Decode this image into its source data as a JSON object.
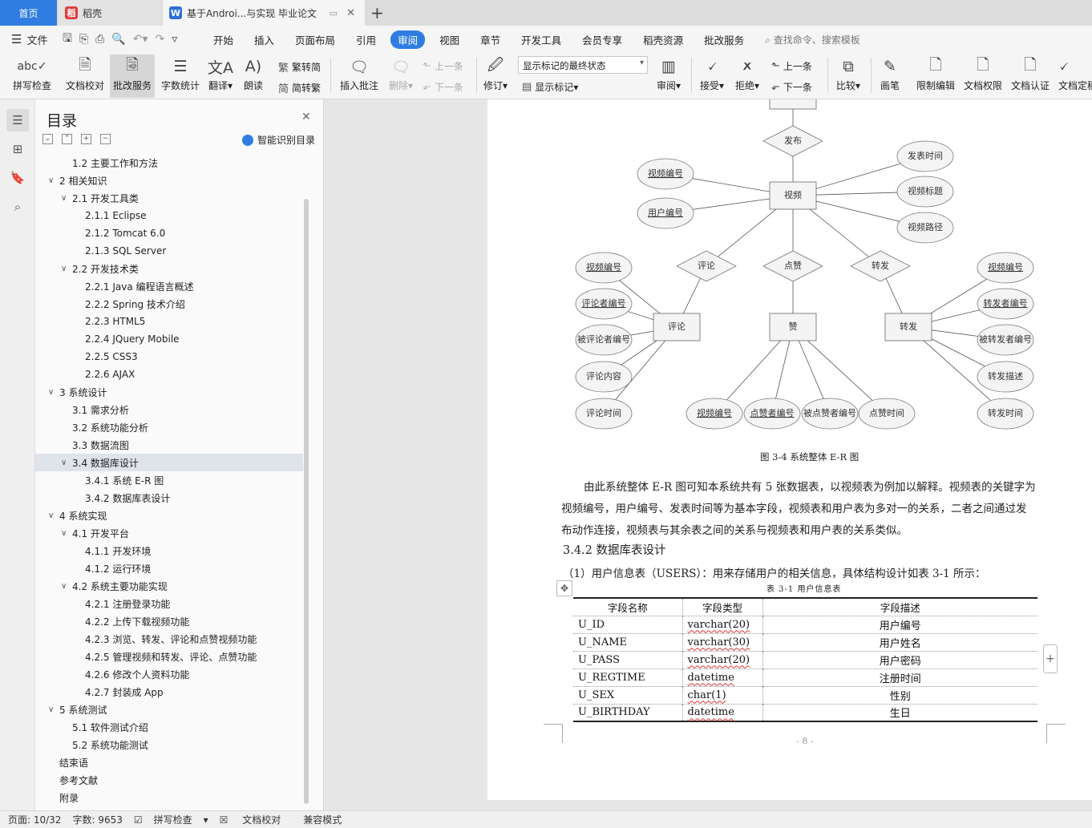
{
  "tabs": {
    "home": "首页",
    "daoke": "稻壳",
    "document": "基于Androi...与实现 毕业论文"
  },
  "menu": {
    "file": "文件",
    "items": [
      "开始",
      "插入",
      "页面布局",
      "引用",
      "审阅",
      "视图",
      "章节",
      "开发工具",
      "会员专享",
      "稻壳资源",
      "批改服务"
    ],
    "active_index": 4,
    "search_placeholder": "查找命令、搜索模板"
  },
  "ribbon": {
    "spell_check": "拼写检查",
    "doc_proofread": "文档校对",
    "revise_service": "批改服务",
    "word_count": "字数统计",
    "translate": "翻译",
    "read_aloud": "朗读",
    "trad_to_simp": "繁转简",
    "simp_to_trad": "简转繁",
    "insert_comment": "插入批注",
    "delete": "删除",
    "prev": "上一条",
    "next": "下一条",
    "revise": "修订",
    "markup_state": "显示标记的最终状态",
    "show_markup": "显示标记",
    "review": "审阅",
    "accept": "接受",
    "reject": "拒绝",
    "prev2": "上一条",
    "next2": "下一条",
    "compare": "比较",
    "pen": "画笔",
    "restrict_edit": "限制编辑",
    "doc_permission": "文档权限",
    "doc_auth": "文档认证",
    "doc_final": "文档定稿"
  },
  "toc": {
    "title": "目录",
    "smart": "智能识别目录",
    "items": [
      {
        "label": "1.2 主要工作和方法",
        "level": 2,
        "chev": false
      },
      {
        "label": "2  相关知识",
        "level": 1,
        "chev": true
      },
      {
        "label": "2.1 开发工具类",
        "level": 2,
        "chev": true
      },
      {
        "label": "2.1.1 Eclipse",
        "level": 3,
        "chev": false
      },
      {
        "label": "2.1.2 Tomcat 6.0",
        "level": 3,
        "chev": false
      },
      {
        "label": "2.1.3 SQL Server",
        "level": 3,
        "chev": false
      },
      {
        "label": "2.2 开发技术类",
        "level": 2,
        "chev": true
      },
      {
        "label": "2.2.1 Java 编程语言概述",
        "level": 3,
        "chev": false
      },
      {
        "label": "2.2.2 Spring 技术介绍",
        "level": 3,
        "chev": false
      },
      {
        "label": "2.2.3 HTML5",
        "level": 3,
        "chev": false
      },
      {
        "label": "2.2.4 JQuery Mobile",
        "level": 3,
        "chev": false
      },
      {
        "label": "2.2.5 CSS3",
        "level": 3,
        "chev": false
      },
      {
        "label": "2.2.6 AJAX",
        "level": 3,
        "chev": false
      },
      {
        "label": "3  系统设计",
        "level": 1,
        "chev": true
      },
      {
        "label": "3.1 需求分析",
        "level": 2,
        "chev": false
      },
      {
        "label": "3.2 系统功能分析",
        "level": 2,
        "chev": false
      },
      {
        "label": "3.3 数据流图",
        "level": 2,
        "chev": false
      },
      {
        "label": "3.4 数据库设计",
        "level": 2,
        "chev": true
      },
      {
        "label": "3.4.1 系统 E-R 图",
        "level": 3,
        "chev": false
      },
      {
        "label": "3.4.2 数据库表设计",
        "level": 3,
        "chev": false
      },
      {
        "label": "4  系统实现",
        "level": 1,
        "chev": true
      },
      {
        "label": "4.1 开发平台",
        "level": 2,
        "chev": true
      },
      {
        "label": "4.1.1 开发环境",
        "level": 3,
        "chev": false
      },
      {
        "label": "4.1.2 运行环境",
        "level": 3,
        "chev": false
      },
      {
        "label": "4.2 系统主要功能实现",
        "level": 2,
        "chev": true
      },
      {
        "label": "4.2.1 注册登录功能",
        "level": 3,
        "chev": false
      },
      {
        "label": "4.2.2 上传下载视频功能",
        "level": 3,
        "chev": false
      },
      {
        "label": "4.2.3 浏览、转发、评论和点赞视频功能",
        "level": 3,
        "chev": false
      },
      {
        "label": "4.2.5 管理视频和转发、评论、点赞功能",
        "level": 3,
        "chev": false
      },
      {
        "label": "4.2.6 修改个人资料功能",
        "level": 3,
        "chev": false
      },
      {
        "label": "4.2.7 封装成 App",
        "level": 3,
        "chev": false
      },
      {
        "label": "5  系统测试",
        "level": 1,
        "chev": true
      },
      {
        "label": "5.1 软件测试介绍",
        "level": 2,
        "chev": false
      },
      {
        "label": "5.2 系统功能测试",
        "level": 2,
        "chev": false
      },
      {
        "label": "结束语",
        "level": 0,
        "chev": false
      },
      {
        "label": "参考文献",
        "level": 0,
        "chev": false
      },
      {
        "label": "附录",
        "level": 0,
        "chev": false
      }
    ],
    "selected_index": 17
  },
  "er": {
    "entities": [
      "视频",
      "评论",
      "赞",
      "转发"
    ],
    "relations": [
      "发布",
      "评论",
      "点赞",
      "转发"
    ],
    "video_attrs": [
      "视频编号",
      "用户编号",
      "发表时间",
      "视频标题",
      "视频路径"
    ],
    "comment_attrs": [
      "视频编号",
      "评论者编号",
      "被评论者编号",
      "评论内容",
      "评论时间"
    ],
    "like_attrs": [
      "视频编号",
      "点赞者编号",
      "被点赞者编号",
      "点赞时间"
    ],
    "forward_attrs": [
      "视频编号",
      "转发者编号",
      "被转发者编号",
      "转发描述",
      "转发时间"
    ]
  },
  "doc": {
    "figure_caption": "图 3-4 系统整体 E-R 图",
    "para_line1": "由此系统整体 E-R 图可知本系统共有 5 张数据表，以视频表为例加以解释。视频表的关键字为",
    "para_line2": "视频编号，用户编号、发表时间等为基本字段，视频表和用户表为多对一的关系，二者之间通过发",
    "para_line3": "布动作连接，视频表与其余表之间的关系与视频表和用户表的关系类似。",
    "heading": "3.4.2 数据库表设计",
    "table_intro": "（1）用户信息表（USERS）：用来存储用户的相关信息，具体结构设计如表 3-1 所示：",
    "table_caption": "表 3-1  用户信息表",
    "table_headers": [
      "字段名称",
      "字段类型",
      "字段描述"
    ],
    "table_rows": [
      [
        "U_ID",
        "varchar(20)",
        "用户编号"
      ],
      [
        "U_NAME",
        "varchar(30)",
        "用户姓名"
      ],
      [
        "U_PASS",
        "varchar(20)",
        "用户密码"
      ],
      [
        "U_REGTIME",
        "datetime",
        "注册时间"
      ],
      [
        "U_SEX",
        "char(1)",
        "性别"
      ],
      [
        "U_BIRTHDAY",
        "datetime",
        "生日"
      ]
    ],
    "page_number": "- 8 -"
  },
  "status": {
    "page": "页面: 10/32",
    "words": "字数: 9653",
    "spell": "拼写检查",
    "proof": "文档校对",
    "compat": "兼容模式"
  },
  "colors": {
    "accent": "#2f7de1",
    "daoke_logo": "#e03c3c",
    "wps_logo": "#2f6fd6"
  }
}
